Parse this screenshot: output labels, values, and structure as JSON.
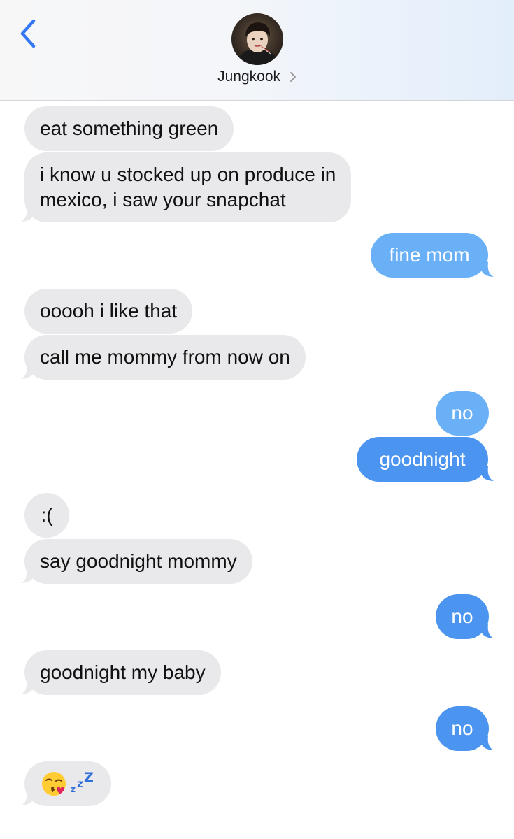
{
  "header": {
    "contact_name": "Jungkook",
    "back_icon": "chevron-left-icon",
    "disclosure_icon": "chevron-right-icon"
  },
  "colors": {
    "incoming_bubble": "#e9e9eb",
    "outgoing_bubble": "#4b95f0",
    "outgoing_bubble_light": "#6ab0f6",
    "ios_blue": "#3478f6"
  },
  "messages": [
    {
      "sender": "contact",
      "text": "eat something green"
    },
    {
      "sender": "contact",
      "line1": "i know u stocked up on produce in",
      "line2": "mexico, i saw your snapchat"
    },
    {
      "sender": "me",
      "text": "fine mom"
    },
    {
      "sender": "contact",
      "text": "ooooh i like that"
    },
    {
      "sender": "contact",
      "text": "call me mommy from now on"
    },
    {
      "sender": "me",
      "text": "no"
    },
    {
      "sender": "me",
      "text": "goodnight"
    },
    {
      "sender": "contact",
      "text": ":("
    },
    {
      "sender": "contact",
      "text": "say goodnight mommy"
    },
    {
      "sender": "me",
      "text": "no"
    },
    {
      "sender": "contact",
      "text": "goodnight my baby"
    },
    {
      "sender": "me",
      "text": "no"
    },
    {
      "sender": "contact",
      "text": "😘💤",
      "emoji_names": [
        "kissing-face-with-heart-icon",
        "zzz-sleep-icon"
      ]
    }
  ]
}
